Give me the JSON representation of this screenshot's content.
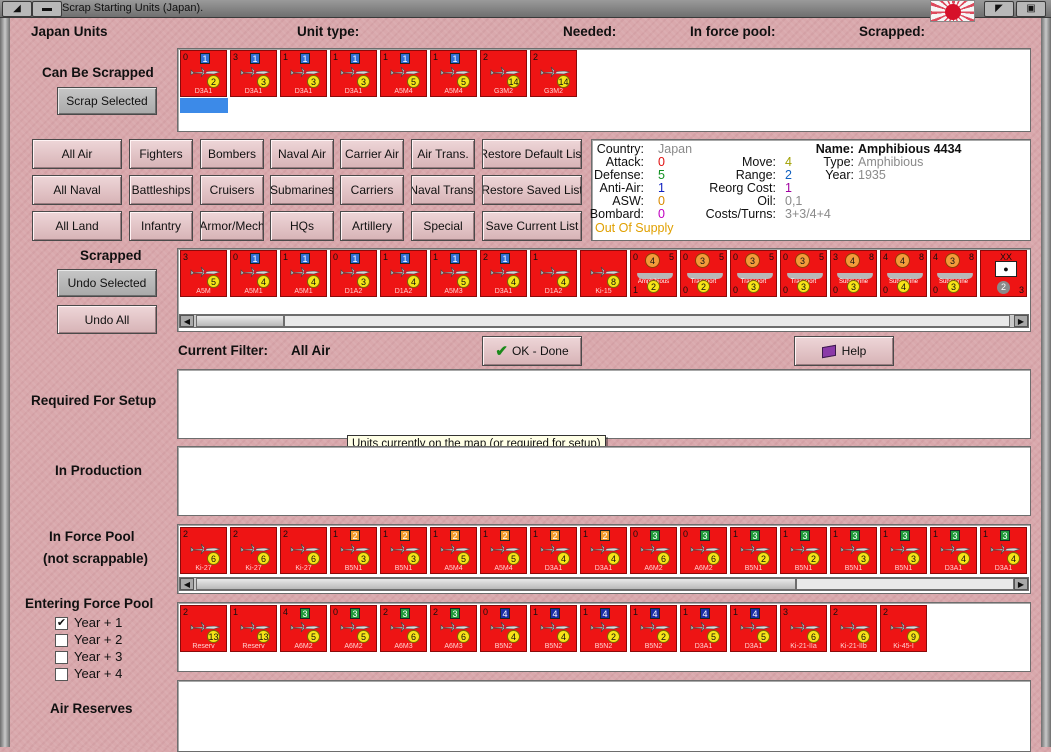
{
  "window": {
    "title": "Scrap Starting Units (Japan)."
  },
  "header": {
    "units_label": "Japan Units",
    "unit_type": "Unit type:",
    "needed": "Needed:",
    "in_force_pool": "In force pool:",
    "scrapped": "Scrapped:"
  },
  "sections": {
    "can_be_scrapped": "Can Be Scrapped",
    "scrapped": "Scrapped",
    "current_filter_label": "Current Filter:",
    "current_filter_value": "All Air",
    "required_for_setup": "Required For Setup",
    "in_production": "In Production",
    "in_force_pool_line1": "In Force Pool",
    "in_force_pool_line2": "(not scrappable)",
    "entering_force_pool": "Entering Force Pool",
    "air_reserves": "Air Reserves"
  },
  "buttons": {
    "scrap_selected": "Scrap Selected",
    "undo_selected": "Undo Selected",
    "undo_all": "Undo All",
    "ok_done": "OK - Done",
    "help": "Help"
  },
  "filters": {
    "row1": [
      "All Air",
      "Fighters",
      "Bombers",
      "Naval Air",
      "Carrier Air",
      "Air Trans.",
      "Restore Default List"
    ],
    "row2": [
      "All Naval",
      "Battleships",
      "Cruisers",
      "Submarines",
      "Carriers",
      "Naval Trans.",
      "Restore Saved List"
    ],
    "row3": [
      "All Land",
      "Infantry",
      "Armor/Mech",
      "HQs",
      "Artillery",
      "Special",
      "Save Current List"
    ]
  },
  "info": {
    "country_label": "Country:",
    "country": "Japan",
    "attack_label": "Attack:",
    "attack": "0",
    "defense_label": "Defense:",
    "defense": "5",
    "antiair_label": "Anti-Air:",
    "antiair": "1",
    "asw_label": "ASW:",
    "asw": "0",
    "bombard_label": "Bombard:",
    "bombard": "0",
    "supply": "Out Of Supply",
    "move_label": "Move:",
    "move": "4",
    "range_label": "Range:",
    "range": "2",
    "reorg_label": "Reorg Cost:",
    "reorg": "1",
    "oil_label": "Oil:",
    "oil": "0,1",
    "costs_label": "Costs/Turns:",
    "costs": "3+3/4+4",
    "name_label": "Name:",
    "name": "Amphibious 4434",
    "type_label": "Type:",
    "type": "Amphibious",
    "year_label": "Year:",
    "year": "1935",
    "colors": {
      "attack": "#e01010",
      "defense": "#109020",
      "antiair": "#1020c0",
      "asw": "#d88a00",
      "bombard": "#c000c0",
      "supply": "#e0a000",
      "move": "#a0a000",
      "range": "#1060c0",
      "reorg": "#a000a0",
      "gray": "#8a8a8a"
    }
  },
  "tooltip": "Units currently on the map (or required for setup)",
  "year_checkboxes": [
    {
      "label": "Year + 1",
      "checked": true
    },
    {
      "label": "Year + 2",
      "checked": false
    },
    {
      "label": "Year + 3",
      "checked": false
    },
    {
      "label": "Year + 4",
      "checked": false
    }
  ],
  "can_be_scrapped_units": [
    {
      "tl": "0",
      "box": "1",
      "box_color": "#2f6fd8",
      "circ": "2",
      "model": "D3A1",
      "tr": ""
    },
    {
      "tl": "3",
      "box": "1",
      "box_color": "#2f6fd8",
      "circ": "3",
      "model": "D3A1",
      "tr": ""
    },
    {
      "tl": "1",
      "box": "1",
      "box_color": "#2f6fd8",
      "circ": "3",
      "model": "D3A1",
      "tr": ""
    },
    {
      "tl": "1",
      "box": "1",
      "box_color": "#2f6fd8",
      "circ": "3",
      "model": "D3A1",
      "tr": ""
    },
    {
      "tl": "1",
      "box": "1",
      "box_color": "#2f6fd8",
      "circ": "5",
      "model": "A5M4",
      "tr": ""
    },
    {
      "tl": "1",
      "box": "1",
      "box_color": "#2f6fd8",
      "circ": "5",
      "model": "A5M4",
      "tr": ""
    },
    {
      "tl": "2",
      "box": "",
      "box_color": "",
      "circ": "14",
      "model": "G3M2",
      "tr": ""
    },
    {
      "tl": "2",
      "box": "",
      "box_color": "",
      "circ": "14",
      "model": "G3M2",
      "tr": ""
    }
  ],
  "scrapped_units": [
    {
      "tl": "3",
      "box": "",
      "box_color": "",
      "circ": "5",
      "model": "A5M",
      "tr": ""
    },
    {
      "tl": "0",
      "box": "1",
      "box_color": "#2f6fd8",
      "circ": "4",
      "model": "A5M1",
      "tr": ""
    },
    {
      "tl": "1",
      "box": "1",
      "box_color": "#2f6fd8",
      "circ": "4",
      "model": "A5M1",
      "tr": ""
    },
    {
      "tl": "0",
      "box": "1",
      "box_color": "#2f6fd8",
      "circ": "3",
      "model": "D1A2",
      "tr": ""
    },
    {
      "tl": "1",
      "box": "1",
      "box_color": "#2f6fd8",
      "circ": "4",
      "model": "D1A2",
      "tr": ""
    },
    {
      "tl": "1",
      "box": "1",
      "box_color": "#2f6fd8",
      "circ": "5",
      "model": "A5M3",
      "tr": ""
    },
    {
      "tl": "2",
      "box": "1",
      "box_color": "#2f6fd8",
      "circ": "4",
      "model": "D3A1",
      "tr": ""
    },
    {
      "tl": "1",
      "box": "",
      "box_color": "",
      "circ": "4",
      "model": "D1A2",
      "tr": ""
    },
    {
      "tl": "",
      "box": "",
      "box_color": "",
      "circ": "8",
      "model": "Ki-15",
      "tr": ""
    }
  ],
  "scrapped_ships": [
    {
      "tl": "0",
      "oc": "4",
      "tr": "5",
      "name": "Amphibious",
      "bl": "1",
      "yc": "2"
    },
    {
      "tl": "0",
      "oc": "3",
      "tr": "5",
      "name": "Transport",
      "bl": "0",
      "yc": "2"
    },
    {
      "tl": "0",
      "oc": "3",
      "tr": "5",
      "name": "Transport",
      "bl": "0",
      "yc": "3"
    },
    {
      "tl": "0",
      "oc": "3",
      "tr": "5",
      "name": "Transport",
      "bl": "0",
      "yc": "3"
    },
    {
      "tl": "3",
      "oc": "4",
      "tr": "8",
      "name": "Submarine",
      "bl": "0",
      "yc": "3"
    },
    {
      "tl": "4",
      "oc": "4",
      "tr": "8",
      "name": "Submarine",
      "bl": "0",
      "yc": "4"
    },
    {
      "tl": "4",
      "oc": "3",
      "tr": "8",
      "name": "Submarine",
      "bl": "0",
      "yc": "3"
    }
  ],
  "scrapped_hq": {
    "top": "XX",
    "bottom": "2",
    "right": "3"
  },
  "force_pool_units": [
    {
      "tl": "2",
      "box": "",
      "box_color": "",
      "circ": "6",
      "model": "Ki-27",
      "tr": ""
    },
    {
      "tl": "2",
      "box": "",
      "box_color": "",
      "circ": "6",
      "model": "Ki-27",
      "tr": ""
    },
    {
      "tl": "2",
      "box": "",
      "box_color": "",
      "circ": "6",
      "model": "Ki-27",
      "tr": ""
    },
    {
      "tl": "1",
      "box": "2",
      "box_color": "#f09a2a",
      "circ": "3",
      "model": "B5N1",
      "tr": ""
    },
    {
      "tl": "1",
      "box": "2",
      "box_color": "#f09a2a",
      "circ": "3",
      "model": "B5N1",
      "tr": ""
    },
    {
      "tl": "1",
      "box": "2",
      "box_color": "#f09a2a",
      "circ": "5",
      "model": "A5M4",
      "tr": ""
    },
    {
      "tl": "1",
      "box": "2",
      "box_color": "#f09a2a",
      "circ": "5",
      "model": "A5M4",
      "tr": ""
    },
    {
      "tl": "1",
      "box": "2",
      "box_color": "#f09a2a",
      "circ": "4",
      "model": "D3A1",
      "tr": ""
    },
    {
      "tl": "1",
      "box": "2",
      "box_color": "#f09a2a",
      "circ": "4",
      "model": "D3A1",
      "tr": ""
    },
    {
      "tl": "0",
      "box": "3",
      "box_color": "#1f9a3a",
      "circ": "6",
      "model": "A6M2",
      "tr": ""
    },
    {
      "tl": "0",
      "box": "3",
      "box_color": "#1f9a3a",
      "circ": "6",
      "model": "A6M2",
      "tr": ""
    },
    {
      "tl": "1",
      "box": "3",
      "box_color": "#1f9a3a",
      "circ": "2",
      "model": "B5N1",
      "tr": ""
    },
    {
      "tl": "1",
      "box": "3",
      "box_color": "#1f9a3a",
      "circ": "2",
      "model": "B5N1",
      "tr": ""
    },
    {
      "tl": "1",
      "box": "3",
      "box_color": "#1f9a3a",
      "circ": "3",
      "model": "B5N1",
      "tr": ""
    },
    {
      "tl": "1",
      "box": "3",
      "box_color": "#1f9a3a",
      "circ": "3",
      "model": "B5N1",
      "tr": ""
    },
    {
      "tl": "1",
      "box": "3",
      "box_color": "#1f9a3a",
      "circ": "4",
      "model": "D3A1",
      "tr": ""
    },
    {
      "tl": "1",
      "box": "3",
      "box_color": "#1f9a3a",
      "circ": "4",
      "model": "D3A1",
      "tr": ""
    }
  ],
  "entering_units": [
    {
      "tl": "2",
      "box": "",
      "box_color": "",
      "circ": "13",
      "model": "Reserv",
      "tr": ""
    },
    {
      "tl": "1",
      "box": "",
      "box_color": "",
      "circ": "13",
      "model": "Reserv",
      "tr": ""
    },
    {
      "tl": "4",
      "box": "3",
      "box_color": "#1f9a3a",
      "circ": "5",
      "model": "A6M2",
      "tr": ""
    },
    {
      "tl": "0",
      "box": "3",
      "box_color": "#1f9a3a",
      "circ": "5",
      "model": "A6M2",
      "tr": ""
    },
    {
      "tl": "2",
      "box": "3",
      "box_color": "#1f9a3a",
      "circ": "6",
      "model": "A6M3",
      "tr": ""
    },
    {
      "tl": "2",
      "box": "3",
      "box_color": "#1f9a3a",
      "circ": "6",
      "model": "A6M3",
      "tr": ""
    },
    {
      "tl": "0",
      "box": "4",
      "box_color": "#1a2fa8",
      "circ": "4",
      "model": "B5N2",
      "tr": ""
    },
    {
      "tl": "1",
      "box": "4",
      "box_color": "#1a2fa8",
      "circ": "4",
      "model": "B5N2",
      "tr": ""
    },
    {
      "tl": "1",
      "box": "4",
      "box_color": "#1a2fa8",
      "circ": "2",
      "model": "B5N2",
      "tr": ""
    },
    {
      "tl": "1",
      "box": "4",
      "box_color": "#1a2fa8",
      "circ": "2",
      "model": "B5N2",
      "tr": ""
    },
    {
      "tl": "1",
      "box": "4",
      "box_color": "#1a2fa8",
      "circ": "5",
      "model": "D3A1",
      "tr": ""
    },
    {
      "tl": "1",
      "box": "4",
      "box_color": "#1a2fa8",
      "circ": "5",
      "model": "D3A1",
      "tr": ""
    },
    {
      "tl": "3",
      "box": "",
      "box_color": "",
      "circ": "6",
      "model": "Ki-21-IIa",
      "tr": ""
    },
    {
      "tl": "2",
      "box": "",
      "box_color": "",
      "circ": "6",
      "model": "Ki-21-IIb",
      "tr": ""
    },
    {
      "tl": "2",
      "box": "",
      "box_color": "",
      "circ": "9",
      "model": "Ki-45-I",
      "tr": ""
    }
  ]
}
